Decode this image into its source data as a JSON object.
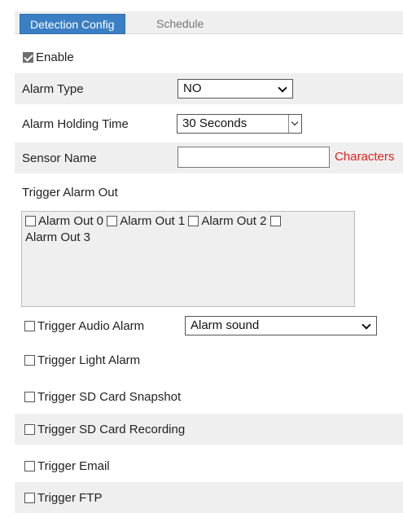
{
  "tabs": [
    {
      "label": "Detection Config",
      "active": true
    },
    {
      "label": "Schedule",
      "active": false
    }
  ],
  "enable": {
    "label": "Enable",
    "checked": true
  },
  "alarm_type": {
    "label": "Alarm Type",
    "value": "NO"
  },
  "holding_time": {
    "label": "Alarm Holding Time",
    "value": "30 Seconds"
  },
  "sensor_name": {
    "label": "Sensor Name",
    "value": "",
    "hint": "Characters"
  },
  "trigger_alarm_out": {
    "label": "Trigger Alarm Out",
    "outputs": [
      {
        "label": "Alarm Out 0",
        "checked": false
      },
      {
        "label": "Alarm Out 1",
        "checked": false
      },
      {
        "label": "Alarm Out 2",
        "checked": false
      },
      {
        "label": "Alarm Out 3",
        "checked": false
      }
    ]
  },
  "audio_alarm": {
    "label": "Trigger Audio Alarm",
    "checked": false,
    "sound": "Alarm sound"
  },
  "light_alarm": {
    "label": "Trigger Light Alarm",
    "checked": false
  },
  "sd_snapshot": {
    "label": "Trigger SD Card Snapshot",
    "checked": false
  },
  "sd_recording": {
    "label": "Trigger SD Card Recording",
    "checked": false
  },
  "email": {
    "label": "Trigger Email",
    "checked": false
  },
  "ftp": {
    "label": "Trigger FTP",
    "checked": false
  },
  "colors": {
    "accent": "#3a7fc4",
    "hint_red": "#e0201c",
    "row_shade": "#efefef"
  }
}
